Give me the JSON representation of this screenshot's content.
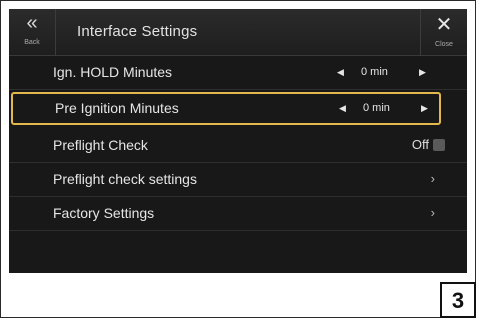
{
  "header": {
    "back_label": "Back",
    "title": "Interface Settings",
    "close_label": "Close"
  },
  "rows": [
    {
      "label": "Ign. HOLD Minutes",
      "value": "0 min"
    },
    {
      "label": "Pre Ignition Minutes",
      "value": "0 min"
    },
    {
      "label": "Preflight Check",
      "value": "Off",
      "checked": false
    },
    {
      "label": "Preflight check settings"
    },
    {
      "label": "Factory Settings"
    }
  ],
  "icons": {
    "back": "double-chevron-left-icon",
    "close": "close-icon",
    "decrement": "triangle-left-icon",
    "increment": "triangle-right-icon",
    "chevron": "chevron-right-icon"
  },
  "colors": {
    "screen_bg": "#181818",
    "highlight": "#e2b84d",
    "text": "#e6e6e6"
  },
  "figure_number": "3"
}
